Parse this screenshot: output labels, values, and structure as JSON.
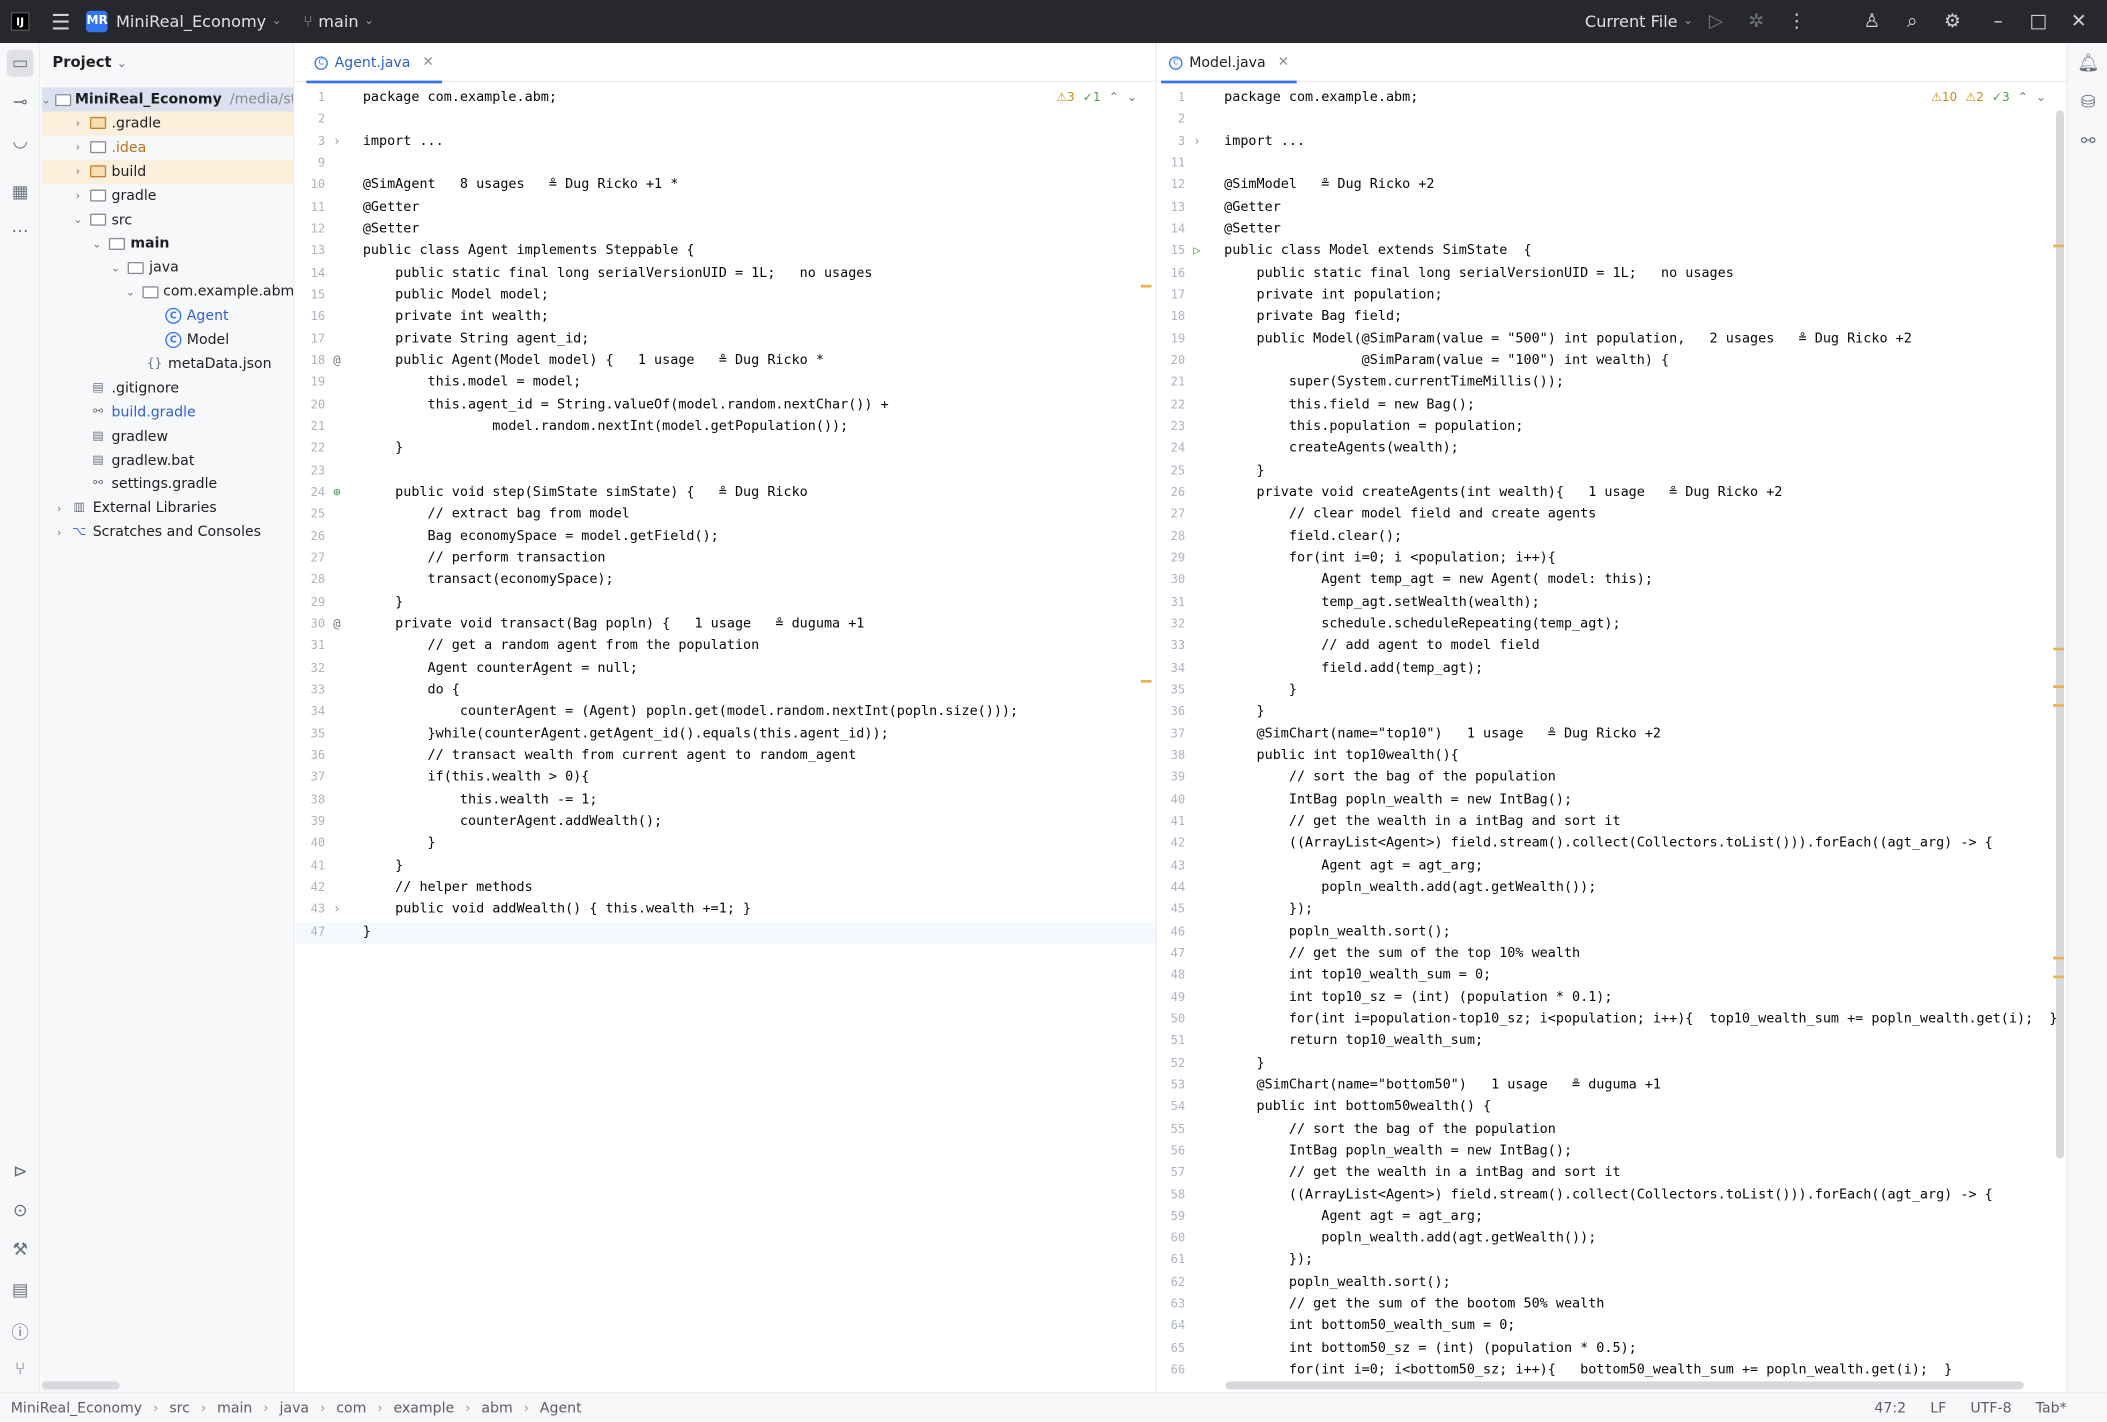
{
  "titlebar": {
    "app_icon": "jetbrains-logo",
    "project_badge": "MR",
    "project_name": "MiniReal_Economy",
    "branch": "main",
    "run_config": "Current File"
  },
  "project_panel": {
    "title": "Project",
    "tree": [
      {
        "label": "MiniReal_Economy",
        "extra": "/media/stora",
        "depth": 0,
        "kind": "module",
        "open": true,
        "bold": true,
        "sel": true
      },
      {
        "label": ".gradle",
        "depth": 1,
        "kind": "folder-orange",
        "arrow": "closed",
        "hl": true
      },
      {
        "label": ".idea",
        "depth": 1,
        "kind": "folder",
        "arrow": "closed",
        "orange": true
      },
      {
        "label": "build",
        "depth": 1,
        "kind": "folder-orange",
        "arrow": "closed",
        "hl": true
      },
      {
        "label": "gradle",
        "depth": 1,
        "kind": "folder",
        "arrow": "closed"
      },
      {
        "label": "src",
        "depth": 1,
        "kind": "folder",
        "arrow": "open"
      },
      {
        "label": "main",
        "depth": 2,
        "kind": "folder",
        "arrow": "open",
        "bold": true
      },
      {
        "label": "java",
        "depth": 3,
        "kind": "folder",
        "arrow": "open"
      },
      {
        "label": "com.example.abm",
        "depth": 4,
        "kind": "package",
        "arrow": "open"
      },
      {
        "label": "Agent",
        "depth": 5,
        "kind": "class",
        "blue": true
      },
      {
        "label": "Model",
        "depth": 5,
        "kind": "class"
      },
      {
        "label": "metaData.json",
        "depth": 4,
        "kind": "json"
      },
      {
        "label": ".gitignore",
        "depth": 1,
        "kind": "file"
      },
      {
        "label": "build.gradle",
        "depth": 1,
        "kind": "gradle",
        "blue": true
      },
      {
        "label": "gradlew",
        "depth": 1,
        "kind": "file"
      },
      {
        "label": "gradlew.bat",
        "depth": 1,
        "kind": "file"
      },
      {
        "label": "settings.gradle",
        "depth": 1,
        "kind": "gradle"
      },
      {
        "label": "External Libraries",
        "depth": 0,
        "kind": "lib",
        "arrow": "closed"
      },
      {
        "label": "Scratches and Consoles",
        "depth": 0,
        "kind": "scratch",
        "arrow": "closed"
      }
    ]
  },
  "left_editor": {
    "tab": "Agent.java",
    "inspections": {
      "warnings": "3",
      "ok": "1"
    },
    "current_line": "47",
    "lines": [
      {
        "n": "1",
        "t": "package com.example.abm;"
      },
      {
        "n": "2",
        "t": ""
      },
      {
        "n": "3",
        "t": "import ..."
      },
      {
        "n": "9",
        "t": ""
      },
      {
        "n": "10",
        "t": "@SimAgent   8 usages   ≗ Dug Ricko +1 *"
      },
      {
        "n": "11",
        "t": "@Getter"
      },
      {
        "n": "12",
        "t": "@Setter"
      },
      {
        "n": "13",
        "t": "public class Agent implements Steppable {"
      },
      {
        "n": "14",
        "t": "    public static final long serialVersionUID = 1L;   no usages"
      },
      {
        "n": "15",
        "t": "    public Model model;"
      },
      {
        "n": "16",
        "t": "    private int wealth;"
      },
      {
        "n": "17",
        "t": "    private String agent_id;"
      },
      {
        "n": "18",
        "t": "    public Agent(Model model) {   1 usage   ≗ Dug Ricko *"
      },
      {
        "n": "19",
        "t": "        this.model = model;"
      },
      {
        "n": "20",
        "t": "        this.agent_id = String.valueOf(model.random.nextChar()) +"
      },
      {
        "n": "21",
        "t": "                model.random.nextInt(model.getPopulation());"
      },
      {
        "n": "22",
        "t": "    }"
      },
      {
        "n": "23",
        "t": ""
      },
      {
        "n": "24",
        "t": "    public void step(SimState simState) {   ≗ Dug Ricko"
      },
      {
        "n": "25",
        "t": "        // extract bag from model"
      },
      {
        "n": "26",
        "t": "        Bag economySpace = model.getField();"
      },
      {
        "n": "27",
        "t": "        // perform transaction"
      },
      {
        "n": "28",
        "t": "        transact(economySpace);"
      },
      {
        "n": "29",
        "t": "    }"
      },
      {
        "n": "30",
        "t": "    private void transact(Bag popln) {   1 usage   ≗ duguma +1"
      },
      {
        "n": "31",
        "t": "        // get a random agent from the population"
      },
      {
        "n": "32",
        "t": "        Agent counterAgent = null;"
      },
      {
        "n": "33",
        "t": "        do {"
      },
      {
        "n": "34",
        "t": "            counterAgent = (Agent) popln.get(model.random.nextInt(popln.size()));"
      },
      {
        "n": "35",
        "t": "        }while(counterAgent.getAgent_id().equals(this.agent_id));"
      },
      {
        "n": "36",
        "t": "        // transact wealth from current agent to random_agent"
      },
      {
        "n": "37",
        "t": "        if(this.wealth > 0){"
      },
      {
        "n": "38",
        "t": "            this.wealth -= 1;"
      },
      {
        "n": "39",
        "t": "            counterAgent.addWealth();"
      },
      {
        "n": "40",
        "t": "        }"
      },
      {
        "n": "41",
        "t": "    }"
      },
      {
        "n": "42",
        "t": "    // helper methods"
      },
      {
        "n": "43",
        "t": "    public void addWealth() { this.wealth +=1; }"
      },
      {
        "n": "47",
        "t": "}"
      }
    ]
  },
  "right_editor": {
    "tab": "Model.java",
    "inspections": {
      "warnings": "10",
      "weak": "2",
      "ok": "3"
    },
    "lines": [
      {
        "n": "1",
        "t": "package com.example.abm;"
      },
      {
        "n": "2",
        "t": ""
      },
      {
        "n": "3",
        "t": "import ..."
      },
      {
        "n": "11",
        "t": ""
      },
      {
        "n": "12",
        "t": "@SimModel   ≗ Dug Ricko +2"
      },
      {
        "n": "13",
        "t": "@Getter"
      },
      {
        "n": "14",
        "t": "@Setter"
      },
      {
        "n": "15",
        "t": "public class Model extends SimState  {"
      },
      {
        "n": "16",
        "t": "    public static final long serialVersionUID = 1L;   no usages"
      },
      {
        "n": "17",
        "t": "    private int population;"
      },
      {
        "n": "18",
        "t": "    private Bag field;"
      },
      {
        "n": "19",
        "t": "    public Model(@SimParam(value = \"500\") int population,   2 usages   ≗ Dug Ricko +2"
      },
      {
        "n": "20",
        "t": "                 @SimParam(value = \"100\") int wealth) {"
      },
      {
        "n": "21",
        "t": "        super(System.currentTimeMillis());"
      },
      {
        "n": "22",
        "t": "        this.field = new Bag();"
      },
      {
        "n": "23",
        "t": "        this.population = population;"
      },
      {
        "n": "24",
        "t": "        createAgents(wealth);"
      },
      {
        "n": "25",
        "t": "    }"
      },
      {
        "n": "26",
        "t": "    private void createAgents(int wealth){   1 usage   ≗ Dug Ricko +2"
      },
      {
        "n": "27",
        "t": "        // clear model field and create agents"
      },
      {
        "n": "28",
        "t": "        field.clear();"
      },
      {
        "n": "29",
        "t": "        for(int i=0; i <population; i++){"
      },
      {
        "n": "30",
        "t": "            Agent temp_agt = new Agent( model: this);"
      },
      {
        "n": "31",
        "t": "            temp_agt.setWealth(wealth);"
      },
      {
        "n": "32",
        "t": "            schedule.scheduleRepeating(temp_agt);"
      },
      {
        "n": "33",
        "t": "            // add agent to model field"
      },
      {
        "n": "34",
        "t": "            field.add(temp_agt);"
      },
      {
        "n": "35",
        "t": "        }"
      },
      {
        "n": "36",
        "t": "    }"
      },
      {
        "n": "37",
        "t": "    @SimChart(name=\"top10\")   1 usage   ≗ Dug Ricko +2"
      },
      {
        "n": "38",
        "t": "    public int top10wealth(){"
      },
      {
        "n": "39",
        "t": "        // sort the bag of the population"
      },
      {
        "n": "40",
        "t": "        IntBag popln_wealth = new IntBag();"
      },
      {
        "n": "41",
        "t": "        // get the wealth in a intBag and sort it"
      },
      {
        "n": "42",
        "t": "        ((ArrayList<Agent>) field.stream().collect(Collectors.toList())).forEach((agt_arg) -> {"
      },
      {
        "n": "43",
        "t": "            Agent agt = agt_arg;"
      },
      {
        "n": "44",
        "t": "            popln_wealth.add(agt.getWealth());"
      },
      {
        "n": "45",
        "t": "        });"
      },
      {
        "n": "46",
        "t": "        popln_wealth.sort();"
      },
      {
        "n": "47",
        "t": "        // get the sum of the top 10% wealth"
      },
      {
        "n": "48",
        "t": "        int top10_wealth_sum = 0;"
      },
      {
        "n": "49",
        "t": "        int top10_sz = (int) (population * 0.1);"
      },
      {
        "n": "50",
        "t": "        for(int i=population-top10_sz; i<population; i++){  top10_wealth_sum += popln_wealth.get(i);  }"
      },
      {
        "n": "51",
        "t": "        return top10_wealth_sum;"
      },
      {
        "n": "52",
        "t": "    }"
      },
      {
        "n": "53",
        "t": "    @SimChart(name=\"bottom50\")   1 usage   ≗ duguma +1"
      },
      {
        "n": "54",
        "t": "    public int bottom50wealth() {"
      },
      {
        "n": "55",
        "t": "        // sort the bag of the population"
      },
      {
        "n": "56",
        "t": "        IntBag popln_wealth = new IntBag();"
      },
      {
        "n": "57",
        "t": "        // get the wealth in a intBag and sort it"
      },
      {
        "n": "58",
        "t": "        ((ArrayList<Agent>) field.stream().collect(Collectors.toList())).forEach((agt_arg) -> {"
      },
      {
        "n": "59",
        "t": "            Agent agt = agt_arg;"
      },
      {
        "n": "60",
        "t": "            popln_wealth.add(agt.getWealth());"
      },
      {
        "n": "61",
        "t": "        });"
      },
      {
        "n": "62",
        "t": "        popln_wealth.sort();"
      },
      {
        "n": "63",
        "t": "        // get the sum of the bootom 50% wealth"
      },
      {
        "n": "64",
        "t": "        int bottom50_wealth_sum = 0;"
      },
      {
        "n": "65",
        "t": "        int bottom50_sz = (int) (population * 0.5);"
      },
      {
        "n": "66",
        "t": "        for(int i=0; i<bottom50_sz; i++){   bottom50_wealth_sum += popln_wealth.get(i);  }"
      }
    ]
  },
  "statusbar": {
    "breadcrumbs": [
      "MiniReal_Economy",
      "src",
      "main",
      "java",
      "com",
      "example",
      "abm",
      "Agent"
    ],
    "position": "47:2",
    "line_sep": "LF",
    "encoding": "UTF-8",
    "indent": "Tab*"
  }
}
